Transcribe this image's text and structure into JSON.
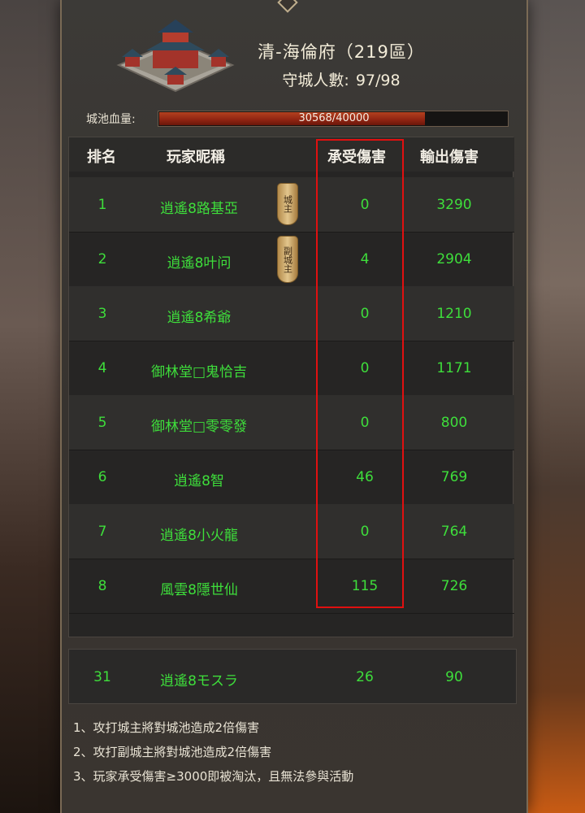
{
  "header": {
    "title": "清-海倫府（219區）",
    "guards_label": "守城人數:",
    "guards_value": "97/98"
  },
  "hp": {
    "label": "城池血量:",
    "text": "30568/40000",
    "fraction": 0.764
  },
  "table": {
    "headers": [
      "排名",
      "玩家昵稱",
      "承受傷害",
      "輸出傷害"
    ],
    "rows": [
      {
        "rank": "1",
        "name": "逍遙8路基亞",
        "taken": "0",
        "dealt": "3290",
        "badge": "城主"
      },
      {
        "rank": "2",
        "name": "逍遙8叶问",
        "taken": "4",
        "dealt": "2904",
        "badge": "副城主"
      },
      {
        "rank": "3",
        "name": "逍遙8希爺",
        "taken": "0",
        "dealt": "1210"
      },
      {
        "rank": "4",
        "name": "御林堂□鬼恰吉",
        "taken": "0",
        "dealt": "1171"
      },
      {
        "rank": "5",
        "name": "御林堂□零零發",
        "taken": "0",
        "dealt": "800"
      },
      {
        "rank": "6",
        "name": "逍遙8智",
        "taken": "46",
        "dealt": "769"
      },
      {
        "rank": "7",
        "name": "逍遙8小火龍",
        "taken": "0",
        "dealt": "764"
      },
      {
        "rank": "8",
        "name": "風雲8隱世仙",
        "taken": "115",
        "dealt": "726"
      }
    ]
  },
  "my_row": {
    "rank": "31",
    "name": "逍遙8モスラ",
    "taken": "26",
    "dealt": "90"
  },
  "rules": [
    "1、攻打城主將對城池造成2倍傷害",
    "2、攻打副城主將對城池造成2倍傷害",
    "3、玩家承受傷害≥3000即被淘汰，且無法參與活動"
  ],
  "colors": {
    "player_text": "#3ede3b",
    "highlight": "#e01010",
    "hp_fill": "#8f2412"
  }
}
